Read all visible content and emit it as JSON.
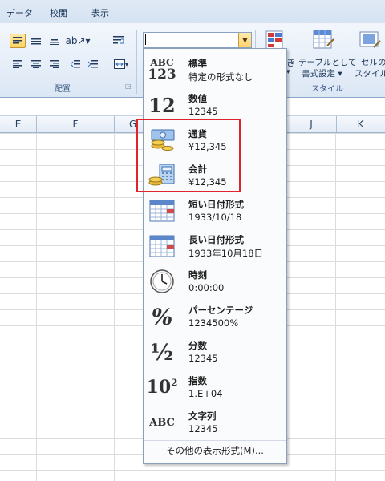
{
  "menu": {
    "tabs": [
      "データ",
      "校閲",
      "表示"
    ]
  },
  "ribbon": {
    "groups": {
      "alignment": "配置",
      "styles": "スタイル"
    },
    "buttons": {
      "format_table": "テーブルとして",
      "format_table2": "書式設定 ▾",
      "cell_styles": "セルの",
      "cell_styles2": "スタイル ▾",
      "conditional_partial": "き"
    }
  },
  "number_format": {
    "value": ""
  },
  "columns": [
    "E",
    "F",
    "G",
    "J",
    "K"
  ],
  "dropdown": {
    "items": [
      {
        "name": "標準",
        "example": "特定の形式なし",
        "icon": "abc123-icon",
        "glyph": "ABC\n123"
      },
      {
        "name": "数値",
        "example": "12345",
        "icon": "number-icon",
        "glyph": "12"
      },
      {
        "name": "通貨",
        "example": "¥12,345",
        "icon": "currency-icon"
      },
      {
        "name": "会計",
        "example": " ¥12,345",
        "icon": "accounting-icon"
      },
      {
        "name": "短い日付形式",
        "example": "1933/10/18",
        "icon": "calendar-icon"
      },
      {
        "name": "長い日付形式",
        "example": "1933年10月18日",
        "icon": "calendar-icon"
      },
      {
        "name": "時刻",
        "example": "0:00:00",
        "icon": "clock-icon"
      },
      {
        "name": "パーセンテージ",
        "example": "1234500%",
        "icon": "percent-icon",
        "glyph": "%"
      },
      {
        "name": "分数",
        "example": "12345",
        "icon": "fraction-icon",
        "glyph": "½"
      },
      {
        "name": "指数",
        "example": "1.E+04",
        "icon": "scientific-icon",
        "glyph": "10²"
      },
      {
        "name": "文字列",
        "example": "12345",
        "icon": "text-icon",
        "glyph": "ABC"
      }
    ],
    "more_label": "その他の表示形式(M)..."
  },
  "colors": {
    "highlight": "#e0242c",
    "accent": "#ffd45e"
  }
}
